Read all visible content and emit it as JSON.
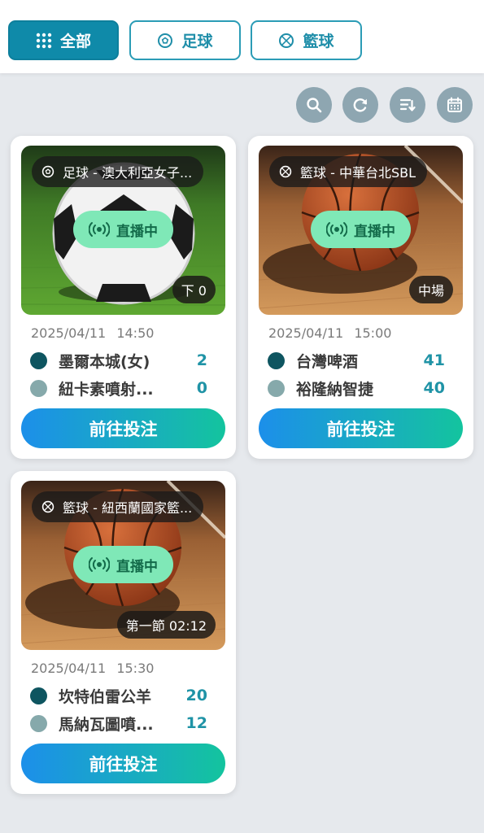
{
  "tabs": [
    {
      "label": "全部",
      "icon": "grid-icon",
      "active": true
    },
    {
      "label": "足球",
      "icon": "soccer-ball-icon",
      "active": false
    },
    {
      "label": "籃球",
      "icon": "basketball-icon",
      "active": false
    }
  ],
  "toolbar": {
    "icons": [
      "search-icon",
      "refresh-icon",
      "sort-icon",
      "calendar-icon"
    ]
  },
  "colors": {
    "accent": "#0f8aa9",
    "live_badge": "#7fe8b7",
    "score": "#1f93a6",
    "home_dot": "#0e5560",
    "away_dot": "#86a9ab"
  },
  "matches": [
    {
      "sport_icon": "soccer-ball-icon",
      "league": "足球 - 澳大利亞女子...",
      "live_label": "直播中",
      "status": "下 0",
      "date": "2025/04/11",
      "time": "14:50",
      "home": {
        "name": "墨爾本城(女)",
        "score": "2"
      },
      "away": {
        "name": "紐卡素噴射...",
        "score": "0"
      },
      "bet_label": "前往投注"
    },
    {
      "sport_icon": "basketball-icon",
      "league": "籃球 - 中華台北SBL",
      "live_label": "直播中",
      "status": "中場",
      "date": "2025/04/11",
      "time": "15:00",
      "home": {
        "name": "台灣啤酒",
        "score": "41"
      },
      "away": {
        "name": "裕隆納智捷",
        "score": "40"
      },
      "bet_label": "前往投注"
    },
    {
      "sport_icon": "basketball-icon",
      "league": "籃球 - 紐西蘭國家籃...",
      "live_label": "直播中",
      "status": "第一節 02:12",
      "date": "2025/04/11",
      "time": "15:30",
      "home": {
        "name": "坎特伯雷公羊",
        "score": "20"
      },
      "away": {
        "name": "馬納瓦圖噴...",
        "score": "12"
      },
      "bet_label": "前往投注"
    }
  ]
}
